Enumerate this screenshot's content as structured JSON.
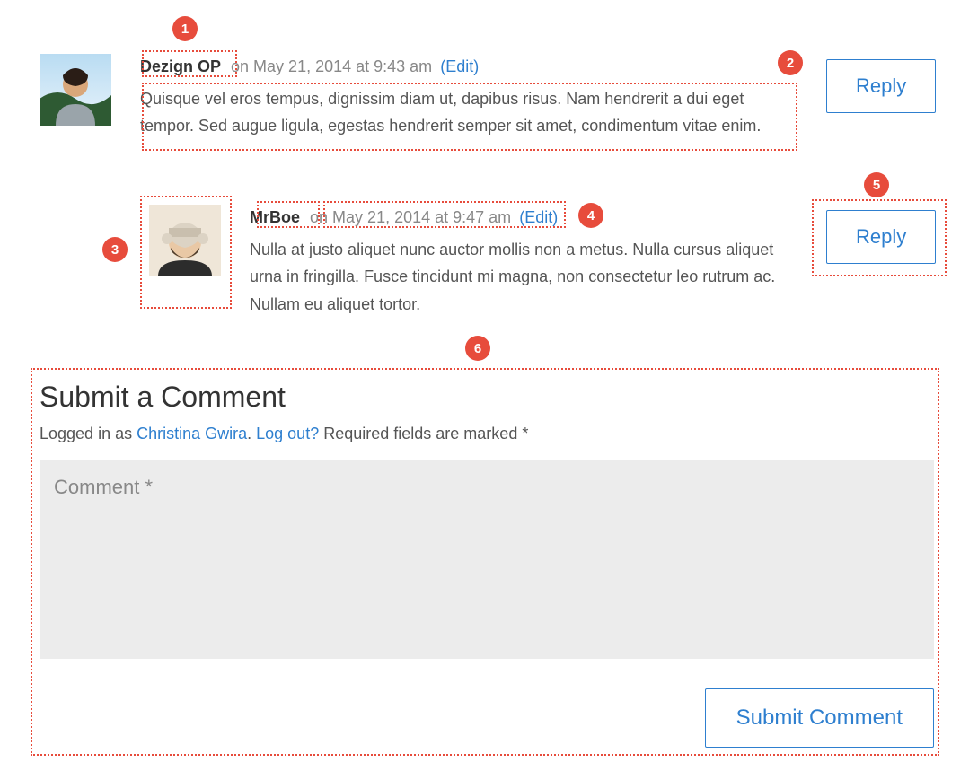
{
  "comments": [
    {
      "author": "Dezign OP",
      "meta": "on May 21, 2014 at 9:43 am",
      "edit": "(Edit)",
      "body": "Quisque vel eros tempus, dignissim diam ut, dapibus risus. Nam hendrerit a dui eget tempor. Sed augue ligula, egestas hendrerit semper sit amet, condimentum vitae enim.",
      "reply_label": "Reply"
    },
    {
      "author": "MrBoe",
      "meta": "on May 21, 2014 at 9:47 am",
      "edit": "(Edit)",
      "body": "Nulla at justo aliquet nunc auctor mollis non a metus. Nulla cursus aliquet urna in fringilla. Fusce tincidunt mi magna, non consectetur leo rutrum ac. Nullam eu aliquet tortor.",
      "reply_label": "Reply"
    }
  ],
  "form": {
    "heading": "Submit a Comment",
    "logged_in_prefix": "Logged in as ",
    "logged_in_user": "Christina Gwira",
    "period": ". ",
    "logout": "Log out?",
    "required_note": " Required fields are marked *",
    "placeholder": "Comment *",
    "submit_label": "Submit Comment"
  },
  "annotations": {
    "b1": "1",
    "b2": "2",
    "b3": "3",
    "b4": "4",
    "b5": "5",
    "b6": "6"
  }
}
